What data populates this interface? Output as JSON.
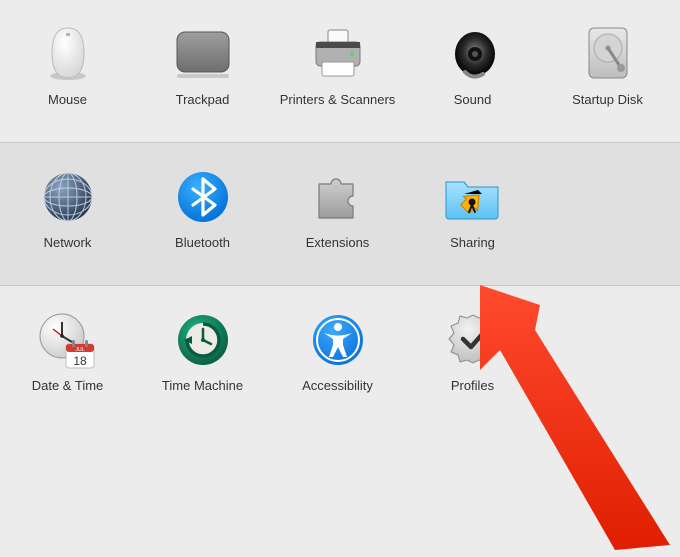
{
  "sections": [
    {
      "items": [
        {
          "key": "mouse",
          "label": "Mouse"
        },
        {
          "key": "trackpad",
          "label": "Trackpad"
        },
        {
          "key": "printers",
          "label": "Printers & Scanners"
        },
        {
          "key": "sound",
          "label": "Sound"
        },
        {
          "key": "startup",
          "label": "Startup Disk"
        }
      ]
    },
    {
      "items": [
        {
          "key": "network",
          "label": "Network"
        },
        {
          "key": "bluetooth",
          "label": "Bluetooth"
        },
        {
          "key": "extensions",
          "label": "Extensions"
        },
        {
          "key": "sharing",
          "label": "Sharing"
        }
      ]
    },
    {
      "items": [
        {
          "key": "datetime",
          "label": "Date & Time"
        },
        {
          "key": "timemachine",
          "label": "Time Machine"
        },
        {
          "key": "accessibility",
          "label": "Accessibility"
        },
        {
          "key": "profiles",
          "label": "Profiles"
        }
      ]
    }
  ],
  "calendar": {
    "month": "JUL",
    "day": "18"
  },
  "arrow_points_to": "sharing"
}
